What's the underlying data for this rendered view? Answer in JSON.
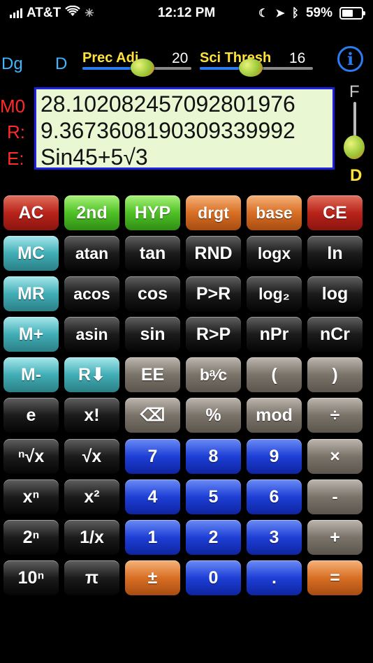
{
  "status": {
    "carrier": "AT&T",
    "time": "12:12 PM",
    "battery": "59%",
    "battery_level": 0.59
  },
  "header": {
    "angle_mode": "Dg",
    "display_mode": "D",
    "prec_adj": {
      "label": "Prec Adj",
      "value": "20",
      "level": 0.55
    },
    "sci_thresh": {
      "label": "Sci Thresh",
      "value": "16",
      "level": 0.45
    },
    "info_icon": "i"
  },
  "registers": {
    "m0_label": "M0",
    "r_label": "R:",
    "e_label": "E:"
  },
  "display": {
    "m0": "28.102082457092801976",
    "result": "9.3673608190309339992",
    "expression": "Sin45+5√3"
  },
  "format_slider": {
    "top_label": "F",
    "bottom_label": "D",
    "level": 1.0
  },
  "keys": [
    [
      {
        "label": "AC",
        "style": "red"
      },
      {
        "label": "2nd",
        "style": "green"
      },
      {
        "label": "HYP",
        "style": "green"
      },
      {
        "label": "drgt",
        "style": "orange"
      },
      {
        "label": "base",
        "style": "orange"
      },
      {
        "label": "CE",
        "style": "red"
      }
    ],
    [
      {
        "label": "MC",
        "style": "teal"
      },
      {
        "label": "atan",
        "style": "black"
      },
      {
        "label": "tan",
        "style": "black"
      },
      {
        "label": "RND",
        "style": "black"
      },
      {
        "label": "logx",
        "style": "black"
      },
      {
        "label": "ln",
        "style": "black"
      }
    ],
    [
      {
        "label": "MR",
        "style": "teal"
      },
      {
        "label": "acos",
        "style": "black"
      },
      {
        "label": "cos",
        "style": "black"
      },
      {
        "label": "P>R",
        "style": "black"
      },
      {
        "label": "log₂",
        "style": "black"
      },
      {
        "label": "log",
        "style": "black"
      }
    ],
    [
      {
        "label": "M+",
        "style": "teal"
      },
      {
        "label": "asin",
        "style": "black"
      },
      {
        "label": "sin",
        "style": "black"
      },
      {
        "label": "R>P",
        "style": "black"
      },
      {
        "label": "nPr",
        "style": "black"
      },
      {
        "label": "nCr",
        "style": "black"
      }
    ],
    [
      {
        "label": "M-",
        "style": "teal"
      },
      {
        "label": "R⬇",
        "style": "teal"
      },
      {
        "label": "EE",
        "style": "gray"
      },
      {
        "label": "bᵃ⁄c",
        "style": "gray"
      },
      {
        "label": "(",
        "style": "gray"
      },
      {
        "label": ")",
        "style": "gray"
      }
    ],
    [
      {
        "label": "e",
        "style": "black"
      },
      {
        "label": "x!",
        "style": "black"
      },
      {
        "label": "⌫",
        "style": "gray"
      },
      {
        "label": "%",
        "style": "gray"
      },
      {
        "label": "mod",
        "style": "gray"
      },
      {
        "label": "÷",
        "style": "gray"
      }
    ],
    [
      {
        "label": "ⁿ√x",
        "style": "black"
      },
      {
        "label": "√x",
        "style": "black"
      },
      {
        "label": "7",
        "style": "blue"
      },
      {
        "label": "8",
        "style": "blue"
      },
      {
        "label": "9",
        "style": "blue"
      },
      {
        "label": "×",
        "style": "gray"
      }
    ],
    [
      {
        "label": "xⁿ",
        "style": "black"
      },
      {
        "label": "x²",
        "style": "black"
      },
      {
        "label": "4",
        "style": "blue"
      },
      {
        "label": "5",
        "style": "blue"
      },
      {
        "label": "6",
        "style": "blue"
      },
      {
        "label": "-",
        "style": "gray"
      }
    ],
    [
      {
        "label": "2ⁿ",
        "style": "black"
      },
      {
        "label": "1/x",
        "style": "black"
      },
      {
        "label": "1",
        "style": "blue"
      },
      {
        "label": "2",
        "style": "blue"
      },
      {
        "label": "3",
        "style": "blue"
      },
      {
        "label": "+",
        "style": "gray"
      }
    ],
    [
      {
        "label": "10ⁿ",
        "style": "black"
      },
      {
        "label": "π",
        "style": "black"
      },
      {
        "label": "±",
        "style": "orange"
      },
      {
        "label": "0",
        "style": "blue"
      },
      {
        "label": ".",
        "style": "blue"
      },
      {
        "label": "=",
        "style": "orange"
      }
    ]
  ]
}
